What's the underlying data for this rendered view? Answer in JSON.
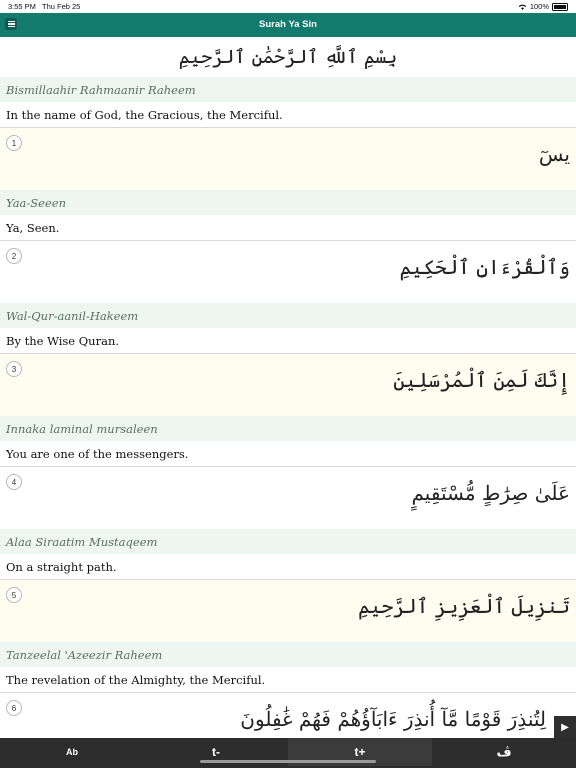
{
  "status": {
    "time": "3:55 PM",
    "date": "Thu Feb 25",
    "battery": "100%"
  },
  "nav": {
    "title": "Surah Ya Sin"
  },
  "bismillah": {
    "arabic": "بِسْمِ ٱللَّهِ ٱلرَّحْمَٰنِ ٱلرَّحِيمِ",
    "transliteration": "Bismillaahir Rahmaanir Raheem",
    "translation": "In the name of God, the Gracious, the Merciful."
  },
  "verses": [
    {
      "number": "1",
      "arabic": "يسٓ",
      "transliteration": "Yaa-Seeen",
      "translation": "Ya, Seen."
    },
    {
      "number": "2",
      "arabic": "وَٱلْقُرْءَانِ ٱلْحَكِيمِ",
      "transliteration": "Wal-Qur-aanil-Hakeem",
      "translation": "By the Wise Quran."
    },
    {
      "number": "3",
      "arabic": "إِنَّكَ لَمِنَ ٱلْمُرْسَلِينَ",
      "transliteration": "Innaka laminal mursaleen",
      "translation": "You are one of the messengers."
    },
    {
      "number": "4",
      "arabic": "عَلَىٰ صِرَٰطٍ مُّسْتَقِيمٍ",
      "transliteration": "Alaa Siraatim Mustaqeem",
      "translation": "On a straight path."
    },
    {
      "number": "5",
      "arabic": "تَنزِيلَ ٱلْعَزِيزِ ٱلرَّحِيمِ",
      "transliteration": "Tanzeelal 'Azeezir Raheem",
      "translation": "The revelation of the Almighty, the Merciful."
    },
    {
      "number": "6",
      "arabic": "لِتُنذِرَ قَوْمًا مَّآ أُنذِرَ ءَابَآؤُهُمْ فَهُمْ غَٰفِلُونَ"
    }
  ],
  "toolbar": {
    "ab": "Ab",
    "text_smaller": "t-",
    "text_larger": "t+",
    "arabic_toggle": "ڤ"
  },
  "icons": {
    "menu": "hamburger-icon",
    "play": "play-icon"
  },
  "colors": {
    "nav_bg": "#137b6e",
    "toolbar_bg": "#2d2d2d",
    "transliteration_bg": "#eef6f1",
    "verse_alt_bg": "#fffdf0"
  }
}
